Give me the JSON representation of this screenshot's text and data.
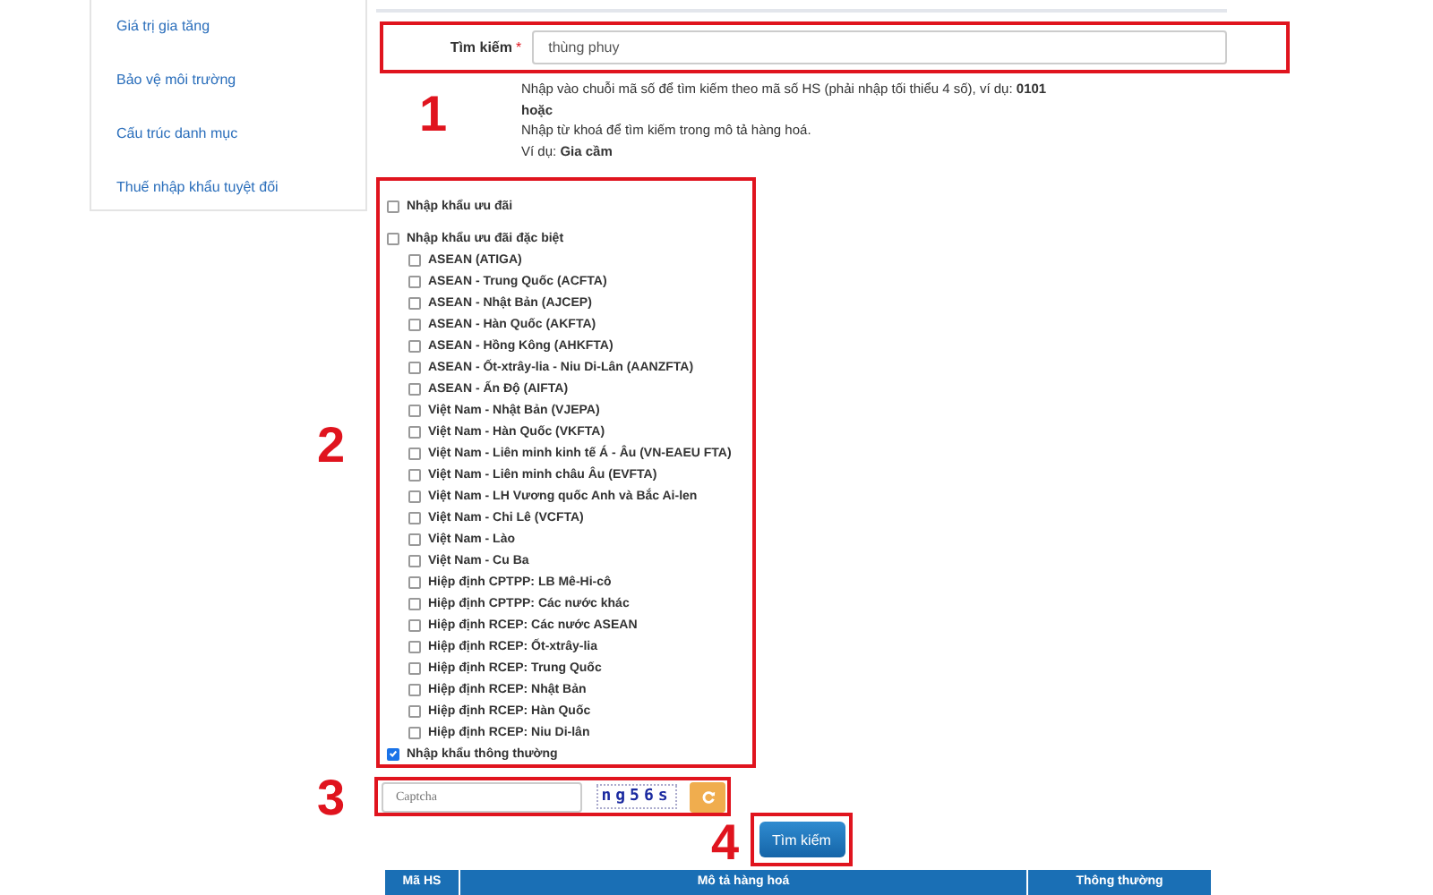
{
  "sidebar": {
    "items": [
      "Giá trị gia tăng",
      "Bảo vệ môi trường",
      "Cấu trúc danh mục",
      "Thuế nhập khẩu tuyệt đối"
    ]
  },
  "search": {
    "annotation": "1",
    "label": "Tìm kiếm",
    "required_mark": "*",
    "value": "thùng phuy",
    "help": [
      "Nhập vào chuỗi mã số để tìm kiếm theo mã số HS (phải nhập tối thiểu 4 số), ví dụ: **0101**",
      "**hoặc**",
      "Nhập từ khoá để tìm kiếm trong mô tả hàng hoá.",
      "Ví dụ: **Gia cầm**"
    ]
  },
  "filters": {
    "annotation": "2",
    "items": [
      {
        "label": "Nhập khẩu ưu đãi",
        "checked": false
      },
      {
        "label": "Nhập khẩu ưu đãi đặc biệt",
        "checked": false,
        "children": [
          {
            "label": "ASEAN (ATIGA)",
            "checked": false
          },
          {
            "label": "ASEAN - Trung Quốc (ACFTA)",
            "checked": false
          },
          {
            "label": "ASEAN - Nhật Bản (AJCEP)",
            "checked": false
          },
          {
            "label": "ASEAN - Hàn Quốc (AKFTA)",
            "checked": false
          },
          {
            "label": "ASEAN - Hồng Kông (AHKFTA)",
            "checked": false
          },
          {
            "label": "ASEAN - Ốt-xtrây-lia - Niu Di-Lân (AANZFTA)",
            "checked": false
          },
          {
            "label": "ASEAN - Ấn Độ (AIFTA)",
            "checked": false
          },
          {
            "label": "Việt Nam - Nhật Bản (VJEPA)",
            "checked": false
          },
          {
            "label": "Việt Nam - Hàn Quốc (VKFTA)",
            "checked": false
          },
          {
            "label": "Việt Nam - Liên minh kinh tế Á - Âu (VN-EAEU FTA)",
            "checked": false
          },
          {
            "label": "Việt Nam - Liên minh châu Âu (EVFTA)",
            "checked": false
          },
          {
            "label": "Việt Nam - LH Vương quốc Anh và Bắc Ai-len",
            "checked": false
          },
          {
            "label": "Việt Nam - Chi Lê (VCFTA)",
            "checked": false
          },
          {
            "label": "Việt Nam - Lào",
            "checked": false
          },
          {
            "label": "Việt Nam - Cu Ba",
            "checked": false
          },
          {
            "label": "Hiệp định CPTPP: LB Mê-Hi-cô",
            "checked": false
          },
          {
            "label": "Hiệp định CPTPP: Các nước khác",
            "checked": false
          },
          {
            "label": "Hiệp định RCEP: Các nước ASEAN",
            "checked": false
          },
          {
            "label": "Hiệp định RCEP: Ốt-xtrây-lia",
            "checked": false
          },
          {
            "label": "Hiệp định RCEP: Trung Quốc",
            "checked": false
          },
          {
            "label": "Hiệp định RCEP: Nhật Bản",
            "checked": false
          },
          {
            "label": "Hiệp định RCEP: Hàn Quốc",
            "checked": false
          },
          {
            "label": "Hiệp định RCEP: Niu Di-lân",
            "checked": false
          }
        ]
      },
      {
        "label": "Nhập khẩu thông thường",
        "checked": true
      }
    ]
  },
  "captcha": {
    "annotation": "3",
    "placeholder": "Captcha",
    "code": "ng56s"
  },
  "submit": {
    "annotation": "4",
    "label": "Tìm kiếm"
  },
  "table": {
    "columns": [
      "Mã HS",
      "Mô tả hàng hoá",
      "Thông thường"
    ]
  }
}
